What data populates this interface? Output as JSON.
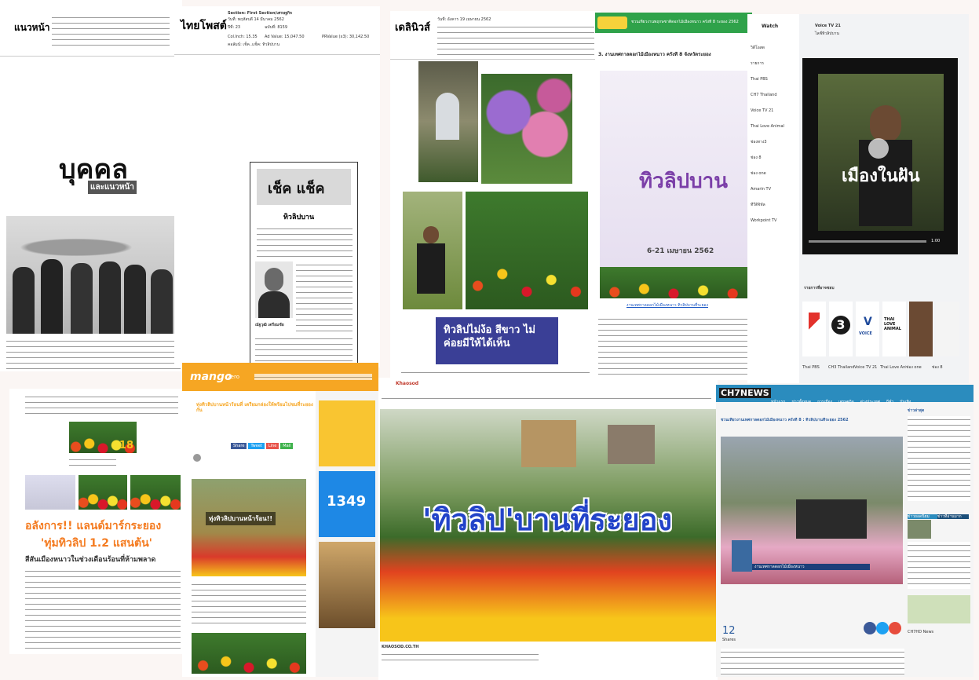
{
  "p1": {
    "masthead": "แนวหน้า",
    "headline": "บุคคล",
    "sub_headline": "และแนวหน้า"
  },
  "p2": {
    "masthead": "ไทยโพสต์",
    "meta": {
      "section": "Section: First Section/เศรษฐกิจ",
      "date": "วันที่: พฤหัสบดี 14 มีนาคม 2562",
      "page": "ปีที่: 23",
      "issue": "ฉบับที่: 8159",
      "col_inch": "Col.Inch: 15.35",
      "ad_value": "Ad Value: 15,047.50",
      "pr_value": "PRValue (x3): 30,142.50",
      "headline": "คอลัมน์: เช็ค..แช็ค: ทิวลิปบาน"
    },
    "column_logo": "เช็ค แช็ค",
    "column_title": "ทิวลิปบาน",
    "byline": "ณัฐวุฒิ เตรียมชัย"
  },
  "p3": {
    "masthead": "เดลินิวส์",
    "meta_date": "วันที่: อังคาร 19 เมษายน 2562",
    "quote": "ทิวลิปไม่ง้อ สีขาว ไม่ค่อยมีให้ได้เห็น"
  },
  "p4": {
    "banner": "ชวนเที่ยวงานพฤกษชาติดอกไม้เมืองหนาว ครั้งที่ 8 ระยอง 2562",
    "title": "3. งานเทศกาลดอกไม้เมืองหนาว ครั้งที่ 8 จังหวัดระยอง",
    "poster_title": "ทิวลิปบาน",
    "poster_dates": "6-21 เมษายน 2562",
    "link": "งานเทศกาลดอกไม้เมืองหนาว ทิวลิปบานที่ระยอง"
  },
  "p5": {
    "sidebar_title": "Watch",
    "channel": "Voice TV 21",
    "video_caption": "เมืองในฝัน",
    "video_title": "ไลฟ์ทิวลิปบาน",
    "time": "1:00",
    "related_header": "รายการที่อาจชอบ",
    "sidebar_items": [
      "วิดีโอสด",
      "รายการ",
      "Thai PBS",
      "CH7 Thailand",
      "Voice TV 21",
      "Thai Love Animal",
      "ช่องทาง3",
      "ช่อง 8",
      "ช่อง one",
      "Amarin TV",
      "ทีวีดิจิทัล",
      "Workpoint TV"
    ],
    "channel_labels": [
      "Thai PBS",
      "CH3 Thailand",
      "Voice TV 21",
      "Thai Love Anim...",
      "ช่อง one",
      "ช่อง 8"
    ],
    "thai_love_logo": "THAI LOVE ANIMAL",
    "voice_logo": "VOICE"
  },
  "p6": {
    "headline_1": "อลังการ!! แลนด์มาร์กระยอง",
    "headline_2": "'ทุ่มทิวลิป 1.2 แสนต้น'",
    "subhead": "สีสันเมืองหนาวในช่วงเดือนร้อนที่ห้ามพลาด",
    "badge": "18"
  },
  "p7": {
    "logo": "mango",
    "logo_suffix": "zero",
    "title": "ทุ่งทิวลิปบานหน้าร้อนที่ เตรียมกล่องให้พร้อมไปชมที่ระยองกัน",
    "hero_text": "ทุ่งทิวลิปบานหน้าร้อน!!",
    "ad_number": "1349",
    "share_buttons": [
      "Share",
      "Tweet",
      "Line",
      "Mail"
    ]
  },
  "p8": {
    "site": "Khaosod",
    "hero_text": "'ทิวลิป'บานที่ระยอง",
    "footer_caption": "KHAOSOD.CO.TH"
  },
  "p9": {
    "logo": "CH7NEWS",
    "nav": [
      "หน้าแรก",
      "ข่าวทั้งหมด",
      "การเมือง",
      "เศรษฐกิจ",
      "ต่างประเทศ",
      "กีฬา",
      "บันเทิง",
      "ไลฟ์สไตล์"
    ],
    "title": "ชวนเที่ยวงานเทศกาลดอกไม้เมืองหนาว ครั้งที่ 8 : ทิวลิปบานที่ระยอง 2562",
    "video_caption": "งานเทศกาลดอกไม้เมืองหนาว",
    "share_count": "12",
    "share_label": "Shares",
    "sidebar_header": "ข่าวล่าสุด",
    "tabs": [
      "ข่าวยอดนิยม",
      "ข่าวที่อ่านมาก"
    ],
    "footer_label": "CH7HD News"
  },
  "colors": {
    "p4_banner": "#2fa24a",
    "p7_orange": "#f6a623",
    "p7_blue": "#1e88e5",
    "p9_nav": "#2b8cbe",
    "quote_bg": "#3a3f96",
    "p6_orange": "#f47b20"
  }
}
